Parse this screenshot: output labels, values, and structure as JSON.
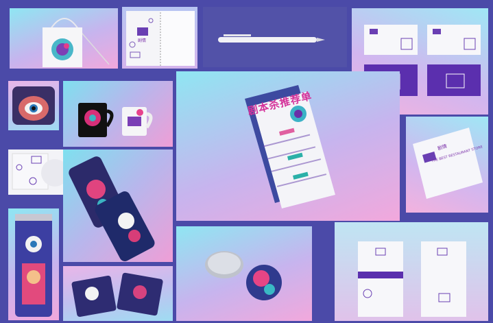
{
  "colors": {
    "frame": "#4b4aa8",
    "brand_purple": "#5a2ea8",
    "brand_pink": "#e0368f",
    "brand_teal": "#2bb6b8",
    "paper": "#f4f3f8"
  },
  "icons": [
    "tote-bag-icon",
    "notebook-icon",
    "pen-icon",
    "pillow-eye-icon",
    "mug-icon",
    "phone-case-icon",
    "can-icon",
    "badge-icon",
    "card-icon"
  ],
  "text": {
    "brand": "剧情",
    "brand_sub": "THE BEST RESTAURANT STORE",
    "menu_title": "剧本杀推荐单"
  }
}
